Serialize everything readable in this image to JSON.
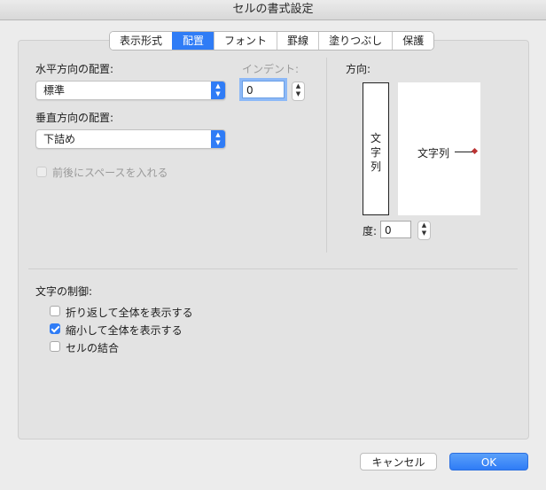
{
  "window": {
    "title": "セルの書式設定"
  },
  "tabs": [
    {
      "label": "表示形式",
      "active": false
    },
    {
      "label": "配置",
      "active": true
    },
    {
      "label": "フォント",
      "active": false
    },
    {
      "label": "罫線",
      "active": false
    },
    {
      "label": "塗りつぶし",
      "active": false
    },
    {
      "label": "保護",
      "active": false
    }
  ],
  "horizontal": {
    "label": "水平方向の配置:",
    "value": "標準"
  },
  "indent": {
    "label": "インデント:",
    "value": "0"
  },
  "vertical": {
    "label": "垂直方向の配置:",
    "value": "下詰め"
  },
  "distributed": {
    "label": "前後にスペースを入れる",
    "checked": false,
    "enabled": false
  },
  "orientation": {
    "label": "方向:",
    "vertical_text": [
      "文",
      "字",
      "列"
    ],
    "horizontal_text": "文字列",
    "degrees_label": "度:",
    "degrees_value": "0"
  },
  "text_control": {
    "label": "文字の制御:",
    "wrap": {
      "label": "折り返して全体を表示する",
      "checked": false
    },
    "shrink": {
      "label": "縮小して全体を表示する",
      "checked": true
    },
    "merge": {
      "label": "セルの結合",
      "checked": false
    }
  },
  "buttons": {
    "cancel": "キャンセル",
    "ok": "OK"
  },
  "colors": {
    "accent": "#2f7cf6",
    "panel": "#e3e3e3",
    "background": "#ececec"
  },
  "icons": {
    "popup": "chevron-up-down-icon",
    "stepper": "stepper-arrows-icon",
    "checkmark": "checkmark-icon"
  }
}
